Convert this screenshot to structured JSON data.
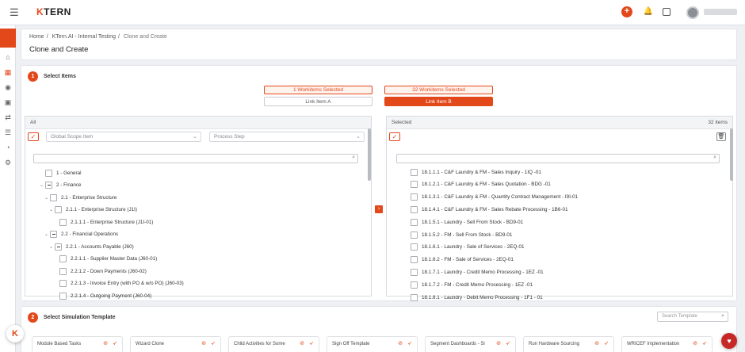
{
  "header": {
    "logo_k": "K",
    "logo_rest": "TERN",
    "menu_icon": "☰",
    "plus": "+",
    "bell": "🔔"
  },
  "breadcrumb": [
    "Home",
    "KTern.AI - Internal Testing",
    "Clone and Create"
  ],
  "page_title": "Clone and Create",
  "step1": {
    "number": "1",
    "title": "Select Items",
    "left_count": "1 Workitems Selected",
    "right_count": "32 Workitems Selected",
    "link_a": "Link Item A",
    "link_b": "Link Item B"
  },
  "left_panel": {
    "header": "All",
    "scope_placeholder": "Global Scope Item",
    "process_placeholder": "Process Step",
    "tree": [
      {
        "label": "1 - General",
        "level": 0,
        "toggle": "",
        "partial": false
      },
      {
        "label": "2 - Finance",
        "level": 0,
        "toggle": "⌄",
        "partial": true
      },
      {
        "label": "2.1 - Enterprise Structure",
        "level": 1,
        "toggle": "⌄",
        "partial": false
      },
      {
        "label": "2.1.1 - Enterprise Structure (J1I)",
        "level": 2,
        "toggle": "⌄",
        "partial": false
      },
      {
        "label": "2.1.1.1 - Enterprise Structure (J1I-01)",
        "level": 3,
        "toggle": "",
        "partial": false
      },
      {
        "label": "2.2 - Financial Operations",
        "level": 1,
        "toggle": "⌄",
        "partial": true
      },
      {
        "label": "2.2.1 - Accounts Payable (J60)",
        "level": 2,
        "toggle": "⌄",
        "partial": true
      },
      {
        "label": "2.2.1.1 - Supplier Master Data (J60-01)",
        "level": 3,
        "toggle": "",
        "partial": false
      },
      {
        "label": "2.2.1.2 - Down Payments (J60-02)",
        "level": 3,
        "toggle": "",
        "partial": false
      },
      {
        "label": "2.2.1.3 - Invoice Entry (with PO & w/o PO) (J60-03)",
        "level": 3,
        "toggle": "",
        "partial": false
      },
      {
        "label": "2.2.1.4 - Outgoing Payment (J60-04)",
        "level": 3,
        "toggle": "",
        "partial": false
      }
    ]
  },
  "right_panel": {
    "header": "Selected",
    "count": "32 items",
    "items": [
      "18.1.1.1 - C&F Laundry & FM - Sales Inquiry - 1IQ -01",
      "18.1.2.1 - C&F Laundry & FM - Sales Quotation - BDG -01",
      "18.1.3.1 - C&F Laundry & FM - Quantity Contract Management - I9I-01",
      "18.1.4.1 - C&F Laundry & FM - Sales Rebate Processing - 1B6-01",
      "18.1.5.1 - Laundry - Sell From Stock - BD9-01",
      "18.1.5.2 - FM - Sell From Stock - BD9-01",
      "18.1.6.1 - Laundry - Sale of Services - 2EQ-01",
      "18.1.6.2 - FM - Sale of Services - 2EQ-01",
      "18.1.7.1 - Laundry - Credit Memo Processing - 1EZ -01",
      "18.1.7.2 - FM - Credit Memo Processing - 1EZ -01",
      "18.1.8.1 - Laundry - Debit Memo Processing - 1F1 - 01"
    ]
  },
  "step2": {
    "number": "2",
    "title": "Select Simulation Template",
    "search_placeholder": "Search Template",
    "templates": [
      "Module Based Tasks",
      "Wizard Clone",
      "Child Activities for Some",
      "Sign Off Template",
      "Segment Dashboards - Si",
      "Run Hardware Sourcing",
      "WRICEF Implementation"
    ]
  },
  "colors": {
    "accent": "#e2481a",
    "bg": "#eef0f3"
  }
}
